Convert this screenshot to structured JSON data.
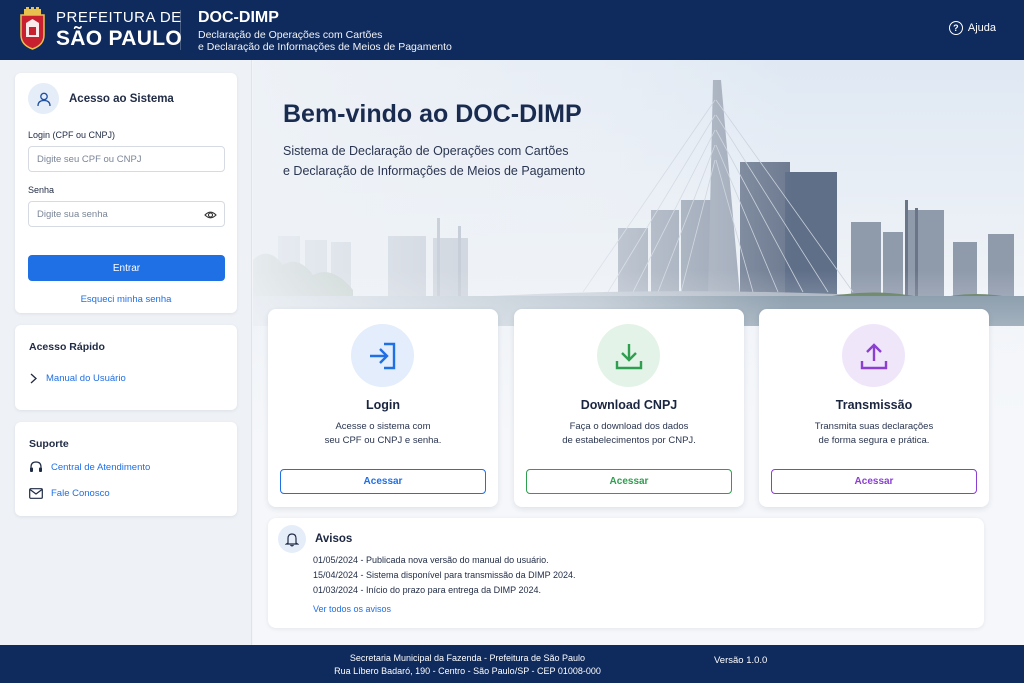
{
  "header": {
    "brand_line1": "PREFEITURA DE",
    "brand_line2": "SÃO PAULO",
    "app_title": "DOC-DIMP",
    "app_subtitle_1": "Declaração de Operações com Cartões",
    "app_subtitle_2": "e Declaração de Informações de Meios de Pagamento",
    "help_label": "Ajuda"
  },
  "sidebar": {
    "login": {
      "title": "Acesso ao Sistema",
      "login_label": "Login (CPF ou CNPJ)",
      "login_placeholder": "Digite seu CPF ou CNPJ",
      "password_label": "Senha",
      "password_placeholder": "Digite sua senha",
      "submit_label": "Entrar",
      "forgot_label": "Esqueci minha senha"
    },
    "quick_access": {
      "title": "Acesso Rápido",
      "items": [
        {
          "label": "Manual do Usuário",
          "icon": "chevron-right-icon"
        }
      ]
    },
    "support": {
      "title": "Suporte",
      "items": [
        {
          "label": "Central de Atendimento",
          "icon": "headset-icon"
        },
        {
          "label": "Fale Conosco",
          "icon": "mail-icon"
        }
      ]
    }
  },
  "hero": {
    "title": "Bem-vindo ao DOC-DIMP",
    "subtitle_1": "Sistema de Declaração de Operações com Cartões",
    "subtitle_2": "e Declaração de Informações de Meios de Pagamento"
  },
  "features": [
    {
      "title": "Login",
      "desc_1": "Acesse o sistema com",
      "desc_2": "seu CPF ou CNPJ e senha.",
      "button": "Acessar",
      "color": "#1f6fe5",
      "icon": "login-icon"
    },
    {
      "title": "Download CNPJ",
      "desc_1": "Faça o download dos dados",
      "desc_2": "de estabelecimentos por CNPJ.",
      "button": "Acessar",
      "color": "#2e9e4f",
      "icon": "download-icon"
    },
    {
      "title": "Transmissão",
      "desc_1": "Transmita suas declarações",
      "desc_2": "de forma segura e prática.",
      "button": "Acessar",
      "color": "#8a3fd1",
      "icon": "upload-icon"
    }
  ],
  "avisos": {
    "title": "Avisos",
    "items": [
      "01/05/2024 - Publicada nova versão do manual do usuário.",
      "15/04/2024 - Sistema disponível para transmissão da DIMP 2024.",
      "01/03/2024 - Início do prazo para entrega da DIMP 2024."
    ],
    "see_all": "Ver todos os avisos"
  },
  "footer": {
    "line1": "Secretaria Municipal da Fazenda - Prefeitura de São Paulo",
    "line2": "Rua Líbero Badaró, 190 - Centro - São Paulo/SP - CEP 01008-000",
    "version": "Versão 1.0.0"
  }
}
